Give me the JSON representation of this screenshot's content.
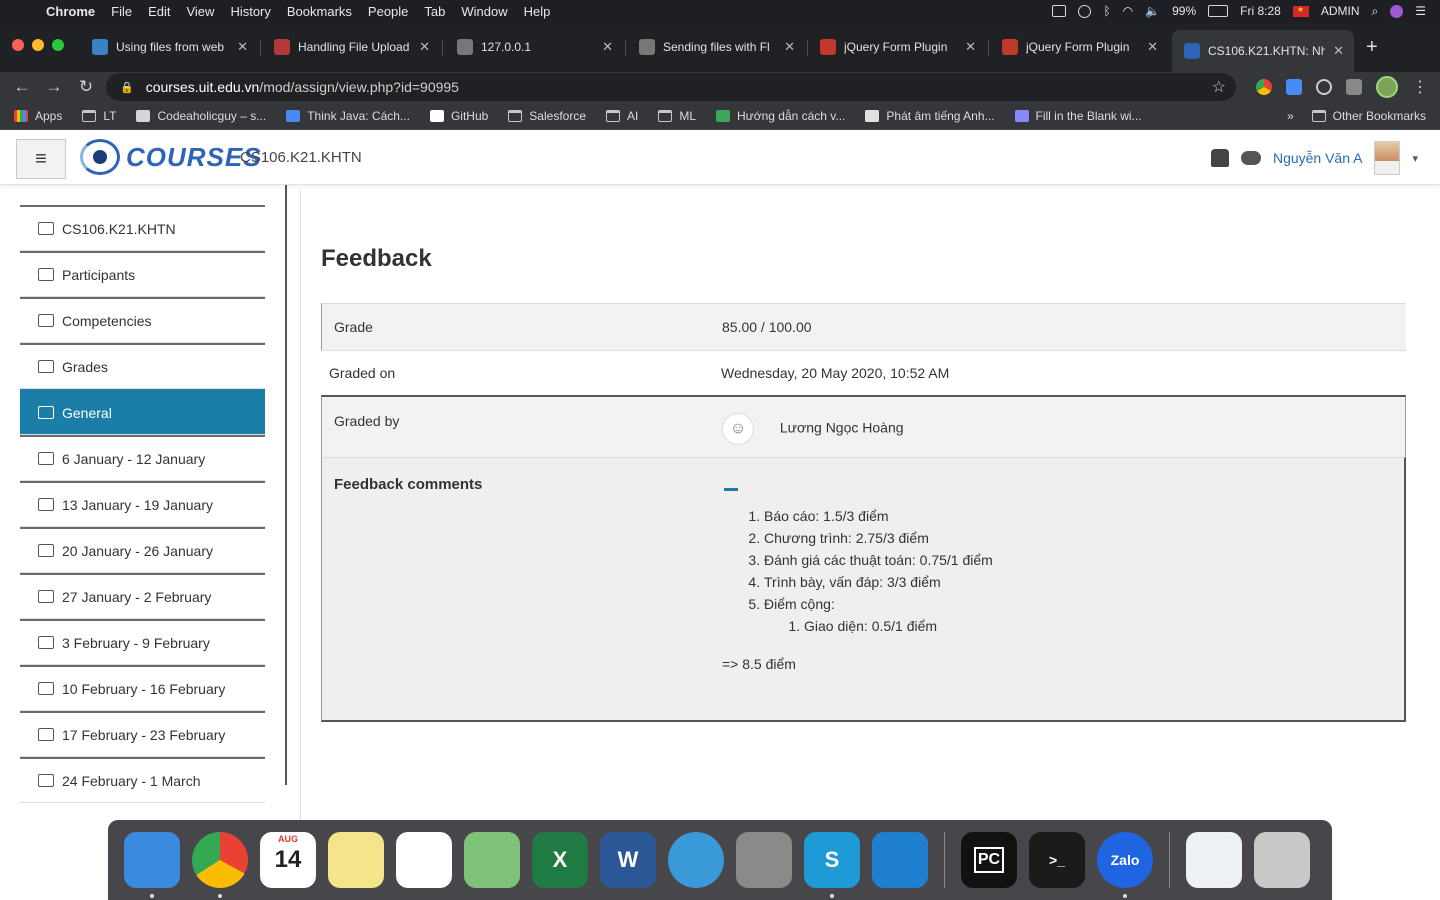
{
  "menubar": {
    "items": [
      "Chrome",
      "File",
      "Edit",
      "View",
      "History",
      "Bookmarks",
      "People",
      "Tab",
      "Window",
      "Help"
    ],
    "battery": "99%",
    "time": "Fri 8:28",
    "user": "ADMIN"
  },
  "tabs": [
    {
      "label": "Using files from web",
      "color": "#3b82c4"
    },
    {
      "label": "Handling File Upload",
      "color": "#b23a3a"
    },
    {
      "label": "127.0.0.1",
      "color": "#777777"
    },
    {
      "label": "Sending files with Fl",
      "color": "#777777"
    },
    {
      "label": "jQuery Form Plugin",
      "color": "#c0392b"
    },
    {
      "label": "jQuery Form Plugin",
      "color": "#c0392b"
    },
    {
      "label": "CS106.K21.KHTN: Nh",
      "color": "#2e63b8"
    }
  ],
  "address": {
    "host": "courses.uit.edu.vn",
    "path": "/mod/assign/view.php?id=90995"
  },
  "bookmarks": {
    "items": [
      "Apps",
      "LT",
      "Codeaholicguy – s...",
      "Think Java: Cách...",
      "GitHub",
      "Salesforce",
      "AI",
      "ML",
      "Hướng dẫn cách v...",
      "Phát âm tiếng Anh...",
      "Fill in the Blank wi..."
    ],
    "more": "»",
    "other": "Other Bookmarks"
  },
  "header": {
    "logo": "COURSES",
    "subtitle": "CS106.K21.KHTN",
    "username": "Nguyễn Văn A"
  },
  "sidebar": {
    "items": [
      {
        "label": "CS106.K21.KHTN",
        "active": false
      },
      {
        "label": "Participants",
        "active": false
      },
      {
        "label": "Competencies",
        "active": false
      },
      {
        "label": "Grades",
        "active": false
      },
      {
        "label": "General",
        "active": true
      },
      {
        "label": "6 January - 12 January",
        "active": false
      },
      {
        "label": "13 January - 19 January",
        "active": false
      },
      {
        "label": "20 January - 26 January",
        "active": false
      },
      {
        "label": "27 January - 2 February",
        "active": false
      },
      {
        "label": "3 February - 9 February",
        "active": false
      },
      {
        "label": "10 February - 16 February",
        "active": false
      },
      {
        "label": "17 February - 23 February",
        "active": false
      },
      {
        "label": "24 February - 1 March",
        "active": false
      }
    ]
  },
  "feedback": {
    "title": "Feedback",
    "grade_label": "Grade",
    "grade_value": "85.00 / 100.00",
    "graded_on_label": "Graded on",
    "graded_on_value": "Wednesday, 20 May 2020, 10:52 AM",
    "graded_by_label": "Graded by",
    "grader_name": "Lương Ngọc Hoàng",
    "comments_label": "Feedback comments",
    "comments": [
      "Báo cáo: 1.5/3 điểm",
      "Chương trình: 2.75/3 điểm",
      "Đánh giá các thuật toán: 0.75/1 điểm",
      "Trình bày, vấn đáp: 3/3 điểm",
      "Điểm cộng:"
    ],
    "bonus": [
      "Giao diện: 0.5/1 điểm"
    ],
    "total": "=> 8.5 điểm"
  },
  "dock": {
    "apps": [
      {
        "name": "finder",
        "color": "#3a8be0",
        "label": ""
      },
      {
        "name": "chrome",
        "color": "#e8e8e8",
        "label": ""
      },
      {
        "name": "calendar",
        "color": "#ffffff",
        "label": "14"
      },
      {
        "name": "notes",
        "color": "#f4e48a",
        "label": ""
      },
      {
        "name": "reminders",
        "color": "#ffffff",
        "label": ""
      },
      {
        "name": "maps",
        "color": "#7fc37a",
        "label": ""
      },
      {
        "name": "excel",
        "color": "#1f7a44",
        "label": "X"
      },
      {
        "name": "word",
        "color": "#2b5797",
        "label": "W"
      },
      {
        "name": "safari",
        "color": "#3a9ad9",
        "label": ""
      },
      {
        "name": "system-preferences",
        "color": "#8a8a8a",
        "label": ""
      },
      {
        "name": "skype",
        "color": "#1e9bd7",
        "label": "S"
      },
      {
        "name": "vscode",
        "color": "#1f7fcf",
        "label": ""
      },
      {
        "name": "pycharm",
        "color": "#111111",
        "label": "PC"
      },
      {
        "name": "terminal",
        "color": "#1b1b1b",
        "label": ">_"
      },
      {
        "name": "zalo",
        "color": "#1f64e0",
        "label": "Zalo"
      },
      {
        "name": "documents",
        "color": "#eef2f6",
        "label": ""
      },
      {
        "name": "trash",
        "color": "#c8c8c8",
        "label": ""
      }
    ],
    "calendar_month": "AUG"
  }
}
